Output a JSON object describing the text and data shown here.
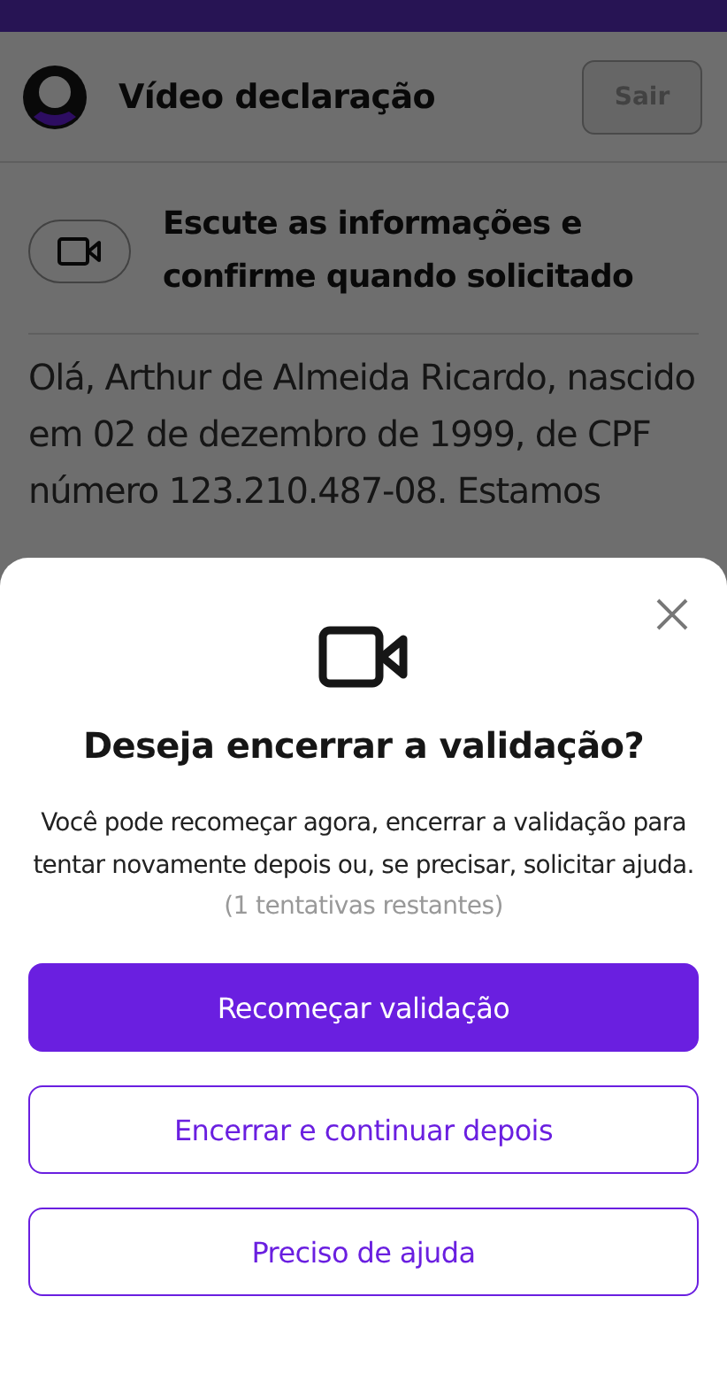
{
  "header": {
    "title": "Vídeo declaração",
    "exit_button": "Sair"
  },
  "instruction": {
    "text": "Escute as informações e confirme quando solicitado"
  },
  "transcript": "Olá, Arthur de Almeida Ricardo, nascido em 02 de dezembro de 1999, de CPF número 123.210.487-08. Estamos",
  "dialog": {
    "title": "Deseja encerrar a validação?",
    "message": "Você pode recomeçar agora, encerrar a validação para tentar novamente depois ou, se precisar, solicitar ajuda.",
    "hint": "(1 tentativas restantes)",
    "buttons": [
      {
        "label": "Recomeçar validação",
        "kind": "primary"
      },
      {
        "label": "Encerrar e continuar depois",
        "kind": "outline"
      },
      {
        "label": "Preciso de ajuda",
        "kind": "outline"
      }
    ]
  }
}
